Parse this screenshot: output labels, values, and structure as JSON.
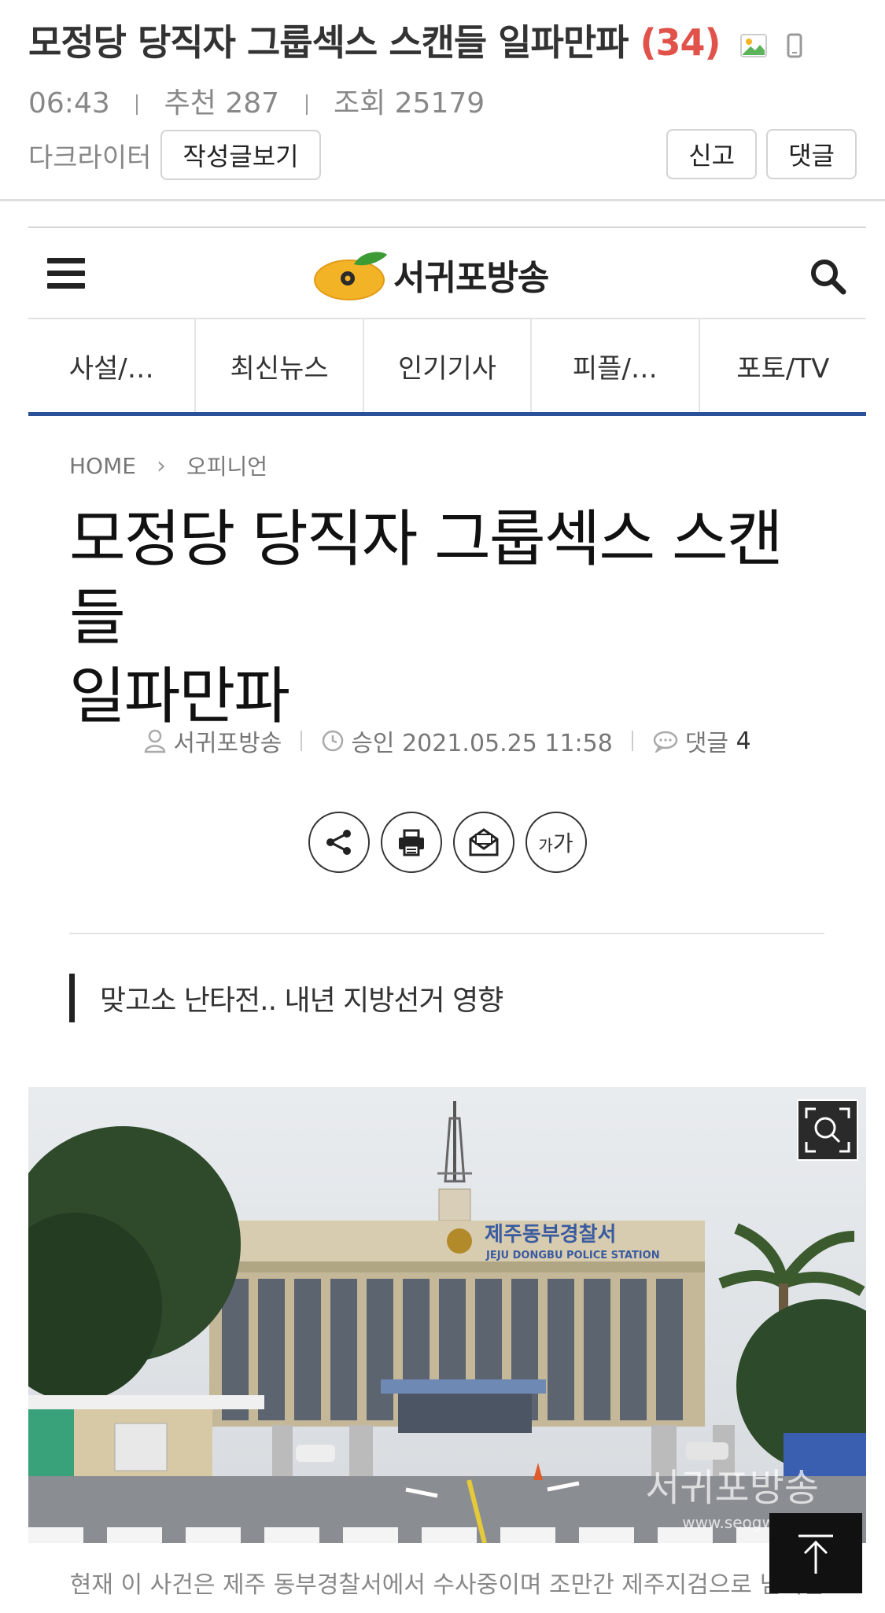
{
  "post": {
    "title": "모정당 당직자 그룹섹스 스캔들 일파만파",
    "comment_count": "(34)",
    "time": "06:43",
    "recommend": "추천 287",
    "views": "조회 25179",
    "author": "다크라이터",
    "view_posts_label": "작성글보기",
    "report_label": "신고",
    "comment_label": "댓글"
  },
  "news": {
    "logo_text": "서귀포방송",
    "nav": [
      "사설/…",
      "최신뉴스",
      "인기기사",
      "피플/…",
      "포토/TV"
    ],
    "breadcrumb": {
      "home": "HOME",
      "section": "오피니언"
    },
    "title_line1": "모정당 당직자 그룹섹스 스캔들",
    "title_line2": "일파만파",
    "byline": {
      "author": "서귀포방송",
      "approved": "승인 2021.05.25 11:58",
      "comments_label": "댓글",
      "comments_count": "4"
    },
    "tools": {
      "font_small": "가",
      "font_large": "가"
    },
    "subtitle": "맞고소 난타전.. 내년 지방선거 영향",
    "photo": {
      "sign_kor": "제주동부경찰서",
      "sign_eng": "JEJU DONGBU POLICE STATION",
      "watermark": "서귀포방송",
      "watermark_url": "www.seogwipo.tv"
    },
    "caption": "현재 이 사건은 제주 동부경찰서에서 수사중이며 조만간 제주지검으로 넘어갈"
  },
  "colors": {
    "accent_red": "#e0524a",
    "nav_blue": "#2a5298"
  }
}
